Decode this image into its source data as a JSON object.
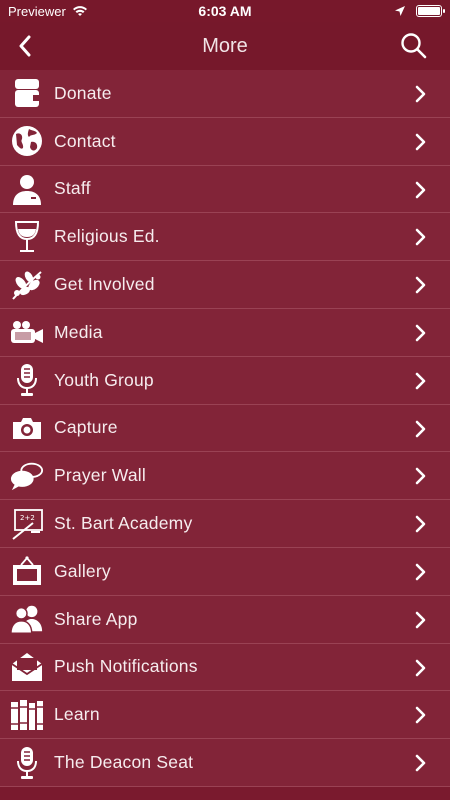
{
  "status_bar": {
    "carrier": "Previewer",
    "time": "6:03 AM"
  },
  "nav": {
    "title": "More"
  },
  "menu": [
    {
      "label": "Donate",
      "icon": "wallet-icon"
    },
    {
      "label": "Contact",
      "icon": "globe-icon"
    },
    {
      "label": "Staff",
      "icon": "person-icon"
    },
    {
      "label": "Religious Ed.",
      "icon": "wine-glass-icon"
    },
    {
      "label": "Get Involved",
      "icon": "olive-branch-icon"
    },
    {
      "label": "Media",
      "icon": "video-camera-icon"
    },
    {
      "label": "Youth Group",
      "icon": "microphone-icon"
    },
    {
      "label": "Capture",
      "icon": "camera-icon"
    },
    {
      "label": "Prayer Wall",
      "icon": "chat-bubbles-icon"
    },
    {
      "label": "St. Bart Academy",
      "icon": "chalkboard-icon"
    },
    {
      "label": "Gallery",
      "icon": "picture-frame-icon"
    },
    {
      "label": "Share App",
      "icon": "people-icon"
    },
    {
      "label": "Push Notifications",
      "icon": "envelope-icon"
    },
    {
      "label": "Learn",
      "icon": "books-icon"
    },
    {
      "label": "The Deacon Seat",
      "icon": "microphone-icon"
    }
  ],
  "colors": {
    "background": "#7a1a2e",
    "nav": "#76182b",
    "row": "#822438",
    "divider": "#9a4254"
  }
}
